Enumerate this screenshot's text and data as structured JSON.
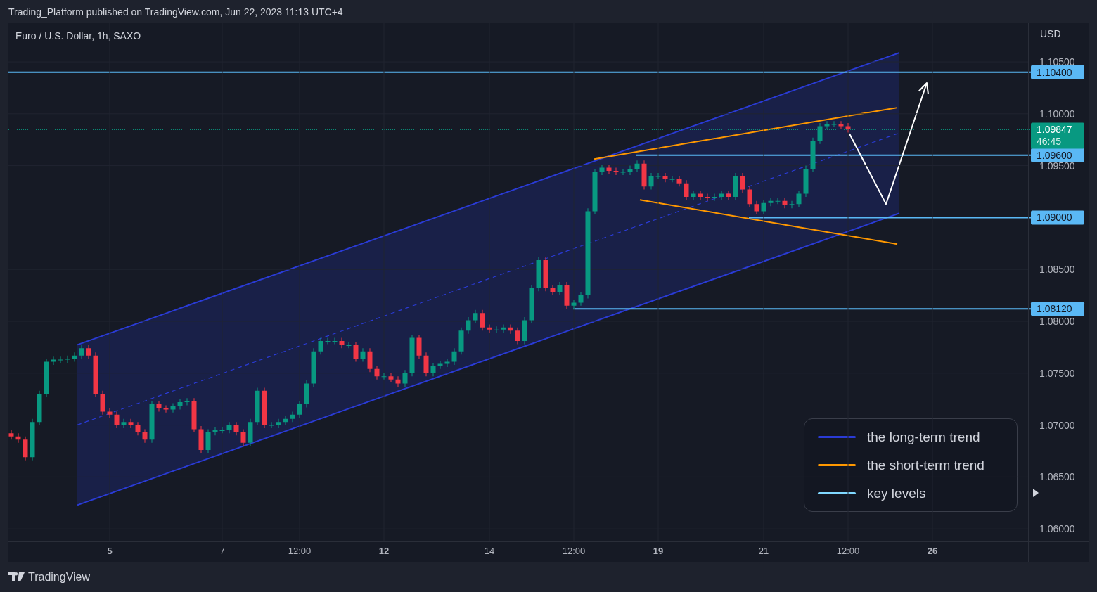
{
  "header": {
    "publisher_line": "Trading_Platform published on TradingView.com, Jun 22, 2023 11:13 UTC+4"
  },
  "chart": {
    "chart_data": {
      "type": "candlestick",
      "title": "Euro / U.S. Dollar, 1h, SAXO",
      "ylabel": "USD",
      "grid": true,
      "ylim": [
        1.05879,
        1.10873
      ],
      "yticks": [
        {
          "value": 1.06,
          "label": "1.06000"
        },
        {
          "value": 1.065,
          "label": "1.06500"
        },
        {
          "value": 1.07,
          "label": "1.07000"
        },
        {
          "value": 1.075,
          "label": "1.07500"
        },
        {
          "value": 1.08,
          "label": "1.08000"
        },
        {
          "value": 1.085,
          "label": "1.08500"
        },
        {
          "value": 1.095,
          "label": "1.09500"
        },
        {
          "value": 1.1,
          "label": "1.10000"
        },
        {
          "value": 1.105,
          "label": "1.10500"
        }
      ],
      "categories": [
        null,
        null,
        null,
        null,
        null,
        null,
        null,
        null,
        null,
        null,
        null,
        null,
        null,
        null,
        "5",
        null,
        null,
        null,
        null,
        null,
        null,
        null,
        null,
        null,
        null,
        null,
        null,
        null,
        null,
        null,
        "7",
        null,
        null,
        null,
        null,
        null,
        null,
        null,
        null,
        null,
        null,
        "12:00",
        null,
        null,
        null,
        null,
        null,
        null,
        null,
        null,
        null,
        null,
        null,
        "12",
        null,
        null,
        null,
        null,
        null,
        null,
        null,
        null,
        null,
        null,
        null,
        null,
        null,
        null,
        "14",
        null,
        null,
        null,
        null,
        null,
        null,
        null,
        null,
        null,
        null,
        null,
        "12:00",
        null,
        null,
        null,
        null,
        null,
        null,
        null,
        null,
        null,
        null,
        null,
        "19",
        null,
        null,
        null,
        null,
        null,
        null,
        null,
        null,
        null,
        null,
        null,
        null,
        null,
        null,
        "21",
        null,
        null,
        null,
        null,
        null,
        null,
        null,
        null,
        null,
        null,
        null,
        "12:00",
        null,
        null,
        null,
        null,
        null,
        null,
        null,
        null,
        null,
        null,
        null,
        "26",
        null,
        null,
        null,
        null,
        null,
        null,
        null,
        null,
        null,
        null,
        null,
        null,
        null
      ],
      "ohlc": [
        [
          1.0692,
          1.0695,
          1.0686,
          1.0689
        ],
        [
          1.0689,
          1.0692,
          1.0683,
          1.0686
        ],
        [
          1.0686,
          1.0689,
          1.0666,
          1.0669
        ],
        [
          1.0669,
          1.0706,
          1.0666,
          1.0703
        ],
        [
          1.0703,
          1.0733,
          1.07,
          1.073
        ],
        [
          1.073,
          1.0764,
          1.0727,
          1.0761
        ],
        [
          1.0761,
          1.0766,
          1.0758,
          1.0763
        ],
        [
          1.0763,
          1.0766,
          1.076,
          1.0763
        ],
        [
          1.0763,
          1.0767,
          1.076,
          1.0764
        ],
        [
          1.0764,
          1.077,
          1.0761,
          1.0767
        ],
        [
          1.0767,
          1.0777,
          1.0764,
          1.0774
        ],
        [
          1.0774,
          1.0777,
          1.0764,
          1.0767
        ],
        [
          1.0767,
          1.077,
          1.0727,
          1.073
        ],
        [
          1.073,
          1.0733,
          1.071,
          1.0713
        ],
        [
          1.0713,
          1.0716,
          1.0707,
          1.071
        ],
        [
          1.071,
          1.0713,
          1.0697,
          1.07
        ],
        [
          1.07,
          1.0706,
          1.0697,
          1.0703
        ],
        [
          1.0703,
          1.0706,
          1.0697,
          1.07
        ],
        [
          1.07,
          1.0703,
          1.069,
          1.0693
        ],
        [
          1.0693,
          1.0696,
          1.0683,
          1.0686
        ],
        [
          1.0686,
          1.0723,
          1.0683,
          1.072
        ],
        [
          1.072,
          1.0723,
          1.0713,
          1.0716
        ],
        [
          1.0716,
          1.0719,
          1.0712,
          1.0715
        ],
        [
          1.0715,
          1.0721,
          1.0712,
          1.0718
        ],
        [
          1.0718,
          1.0725,
          1.0715,
          1.0722
        ],
        [
          1.0722,
          1.0726,
          1.0719,
          1.0723
        ],
        [
          1.0723,
          1.0726,
          1.0693,
          1.0696
        ],
        [
          1.0696,
          1.0699,
          1.0673,
          1.0676
        ],
        [
          1.0676,
          1.0696,
          1.0673,
          1.0693
        ],
        [
          1.0693,
          1.0698,
          1.069,
          1.0695
        ],
        [
          1.0695,
          1.0698,
          1.0692,
          1.0695
        ],
        [
          1.0695,
          1.0703,
          1.0692,
          1.07
        ],
        [
          1.07,
          1.0703,
          1.069,
          1.0693
        ],
        [
          1.0693,
          1.0696,
          1.068,
          1.0683
        ],
        [
          1.0683,
          1.0706,
          1.068,
          1.0703
        ],
        [
          1.0703,
          1.0736,
          1.07,
          1.0733
        ],
        [
          1.0733,
          1.0736,
          1.0697,
          1.07
        ],
        [
          1.07,
          1.0703,
          1.0697,
          1.07
        ],
        [
          1.07,
          1.0706,
          1.0697,
          1.0703
        ],
        [
          1.0703,
          1.0709,
          1.07,
          1.0706
        ],
        [
          1.0706,
          1.0713,
          1.0703,
          1.071
        ],
        [
          1.071,
          1.0723,
          1.0707,
          1.072
        ],
        [
          1.072,
          1.0743,
          1.0717,
          1.074
        ],
        [
          1.074,
          1.0774,
          1.0737,
          1.0771
        ],
        [
          1.0771,
          1.0784,
          1.0768,
          1.0781
        ],
        [
          1.0781,
          1.0784,
          1.0778,
          1.0781
        ],
        [
          1.0781,
          1.0784,
          1.0778,
          1.0781
        ],
        [
          1.0781,
          1.0784,
          1.0774,
          1.0777
        ],
        [
          1.0777,
          1.078,
          1.0774,
          1.0777
        ],
        [
          1.0777,
          1.078,
          1.0761,
          1.0764
        ],
        [
          1.0764,
          1.0774,
          1.0761,
          1.0771
        ],
        [
          1.0771,
          1.0774,
          1.0751,
          1.0754
        ],
        [
          1.0754,
          1.0757,
          1.0744,
          1.0747
        ],
        [
          1.0747,
          1.075,
          1.0744,
          1.0747
        ],
        [
          1.0747,
          1.075,
          1.0741,
          1.0744
        ],
        [
          1.0744,
          1.0747,
          1.0737,
          1.074
        ],
        [
          1.074,
          1.0753,
          1.0737,
          1.075
        ],
        [
          1.075,
          1.0787,
          1.0747,
          1.0784
        ],
        [
          1.0784,
          1.0787,
          1.0764,
          1.0767
        ],
        [
          1.0767,
          1.077,
          1.0747,
          1.075
        ],
        [
          1.075,
          1.076,
          1.0747,
          1.0757
        ],
        [
          1.0757,
          1.0762,
          1.0754,
          1.0759
        ],
        [
          1.0759,
          1.0764,
          1.0756,
          1.0761
        ],
        [
          1.0761,
          1.0774,
          1.0758,
          1.0771
        ],
        [
          1.0771,
          1.0794,
          1.0768,
          1.0791
        ],
        [
          1.0791,
          1.0804,
          1.0788,
          1.0801
        ],
        [
          1.0801,
          1.0811,
          1.0798,
          1.0808
        ],
        [
          1.0808,
          1.0811,
          1.0791,
          1.0794
        ],
        [
          1.0794,
          1.0797,
          1.0789,
          1.0792
        ],
        [
          1.0792,
          1.0795,
          1.0789,
          1.0792
        ],
        [
          1.0792,
          1.0797,
          1.0789,
          1.0794
        ],
        [
          1.0794,
          1.0797,
          1.0788,
          1.0791
        ],
        [
          1.0791,
          1.0794,
          1.0778,
          1.0781
        ],
        [
          1.0781,
          1.0804,
          1.0778,
          1.0801
        ],
        [
          1.0801,
          1.0835,
          1.0798,
          1.0832
        ],
        [
          1.0832,
          1.0862,
          1.0829,
          1.0859
        ],
        [
          1.0859,
          1.0862,
          1.0829,
          1.0832
        ],
        [
          1.0832,
          1.0835,
          1.0825,
          1.0828
        ],
        [
          1.0828,
          1.0838,
          1.0825,
          1.0835
        ],
        [
          1.0835,
          1.0838,
          1.0812,
          1.0815
        ],
        [
          1.0815,
          1.0821,
          1.0812,
          1.0818
        ],
        [
          1.0818,
          1.0828,
          1.0815,
          1.0825
        ],
        [
          1.0825,
          1.0909,
          1.0822,
          1.0906
        ],
        [
          1.0906,
          1.0947,
          1.0903,
          1.0944
        ],
        [
          1.0944,
          1.0951,
          1.0941,
          1.0948
        ],
        [
          1.0948,
          1.0951,
          1.0942,
          1.0945
        ],
        [
          1.0945,
          1.0948,
          1.0941,
          1.0944
        ],
        [
          1.0944,
          1.0947,
          1.0941,
          1.0944
        ],
        [
          1.0944,
          1.095,
          1.0941,
          1.0947
        ],
        [
          1.0947,
          1.0955,
          1.0944,
          1.0952
        ],
        [
          1.0952,
          1.0955,
          1.0927,
          1.093
        ],
        [
          1.093,
          1.0943,
          1.0927,
          1.094
        ],
        [
          1.094,
          1.0943,
          1.0937,
          1.094
        ],
        [
          1.094,
          1.0943,
          1.0934,
          1.0937
        ],
        [
          1.0937,
          1.094,
          1.0934,
          1.0937
        ],
        [
          1.0937,
          1.094,
          1.093,
          1.0933
        ],
        [
          1.0933,
          1.0936,
          1.0917,
          1.092
        ],
        [
          1.092,
          1.0926,
          1.0917,
          1.0923
        ],
        [
          1.0923,
          1.0926,
          1.0917,
          1.092
        ],
        [
          1.092,
          1.0923,
          1.0916,
          1.0919
        ],
        [
          1.0919,
          1.0923,
          1.0916,
          1.092
        ],
        [
          1.092,
          1.0926,
          1.0917,
          1.0923
        ],
        [
          1.0923,
          1.0926,
          1.0917,
          1.092
        ],
        [
          1.092,
          1.0943,
          1.0917,
          1.094
        ],
        [
          1.094,
          1.0943,
          1.0924,
          1.0927
        ],
        [
          1.0927,
          1.093,
          1.091,
          1.0913
        ],
        [
          1.0913,
          1.0916,
          1.0903,
          1.0906
        ],
        [
          1.0906,
          1.0917,
          1.0903,
          1.0914
        ],
        [
          1.0914,
          1.0919,
          1.0911,
          1.0916
        ],
        [
          1.0916,
          1.0919,
          1.0913,
          1.0916
        ],
        [
          1.0916,
          1.0919,
          1.0909,
          1.0912
        ],
        [
          1.0912,
          1.0916,
          1.0909,
          1.0913
        ],
        [
          1.0913,
          1.0926,
          1.091,
          1.0923
        ],
        [
          1.0923,
          1.095,
          1.092,
          1.0947
        ],
        [
          1.0947,
          1.0977,
          1.0944,
          1.0974
        ],
        [
          1.0974,
          1.0991,
          1.0971,
          1.0988
        ],
        [
          1.0988,
          1.0993,
          1.0985,
          1.099
        ],
        [
          1.099,
          1.0993,
          1.0987,
          1.099
        ],
        [
          1.099,
          1.0993,
          1.0985,
          1.0988
        ],
        [
          1.0988,
          1.0991,
          1.0982,
          1.0985
        ],
        null,
        null,
        null,
        null,
        null,
        null,
        null,
        null,
        null,
        null,
        null,
        null,
        null,
        null,
        null,
        null,
        null,
        null,
        null,
        null,
        null,
        null,
        null,
        null,
        null
      ]
    },
    "key_levels": [
      {
        "label": "1.10400",
        "color": "#5ab8f5"
      },
      {
        "label": "1.09600",
        "color": "#5ab8f5"
      },
      {
        "label": "1.09000",
        "color": "#5ab8f5"
      },
      {
        "label": "1.08120",
        "color": "#5ab8f5"
      }
    ],
    "last_price": {
      "price": "1.09847",
      "countdown": "46:45"
    }
  },
  "legend": [
    {
      "label": "the long-term trend",
      "color": "#2a3bd6"
    },
    {
      "label": "the short-term trend",
      "color": "#ff9800"
    },
    {
      "label": "key levels",
      "color": "#80d8ff"
    }
  ],
  "footer": {
    "brand": "TradingView"
  }
}
